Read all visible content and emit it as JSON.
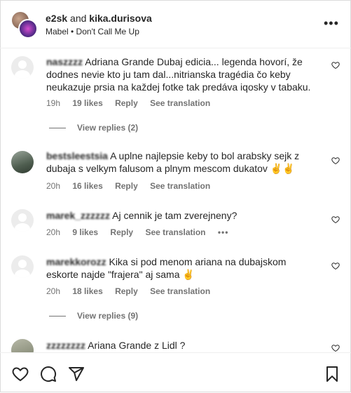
{
  "header": {
    "user1": "e2sk",
    "connector": "and",
    "user2": "kika.durisova",
    "audio": "Mabel • Don't Call Me Up"
  },
  "comments": [
    {
      "username": "naszzzz",
      "text": "Adriana Grande Dubaj edicia... legenda hovorí, že dodnes nevie kto ju tam dal...nitrianska tragédia čo keby neukazuje prsia na každej fotke tak predáva iqosky v tabaku.",
      "time": "19h",
      "likes": "19 likes",
      "reply": "Reply",
      "translate": "See translation",
      "view_replies": "View replies (2)"
    },
    {
      "username": "bestsleestsia",
      "text": "A uplne najlepsie keby to bol arabsky sejk z dubaja s velkym falusom a plnym mescom dukatov ✌️✌️",
      "time": "20h",
      "likes": "16 likes",
      "reply": "Reply",
      "translate": "See translation"
    },
    {
      "username": "marek_zzzzzz",
      "text": "Aj cennik je tam zverejneny?",
      "time": "20h",
      "likes": "9 likes",
      "reply": "Reply",
      "translate": "See translation",
      "more": "•••"
    },
    {
      "username": "marekkorozz",
      "text": "Kika si pod menom ariana na dubajskom eskorte najde \"frajera\" aj sama ✌️",
      "time": "20h",
      "likes": "18 likes",
      "reply": "Reply",
      "translate": "See translation",
      "view_replies": "View replies (9)"
    },
    {
      "username": "zzzzzzzz",
      "text": "Ariana Grande z Lidl ?"
    }
  ]
}
